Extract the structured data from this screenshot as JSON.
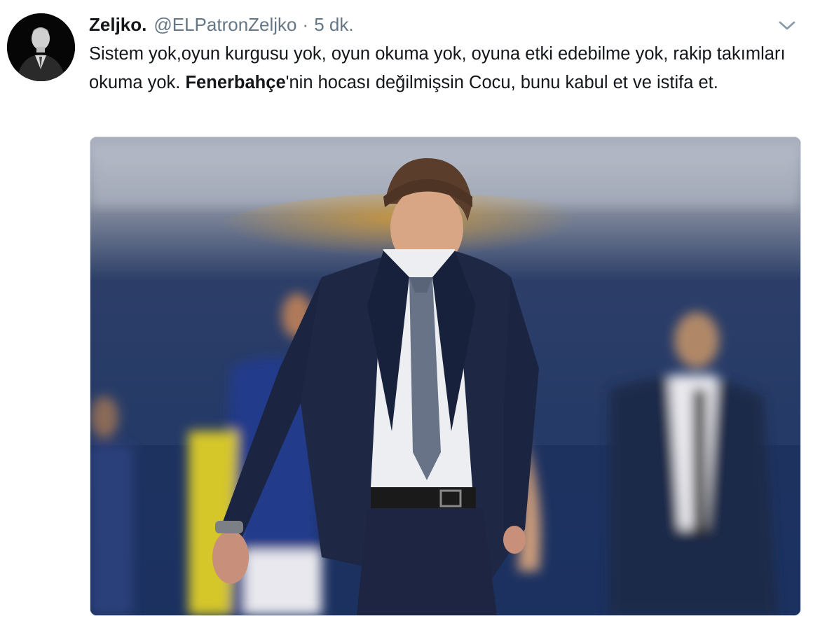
{
  "tweet": {
    "display_name": "Zeljko.",
    "handle": "@ELPatronZeljko",
    "separator": "·",
    "time": "5 dk.",
    "text_part1": "Sistem yok,oyun kurgusu yok, oyun okuma yok, oyuna etki edebilme yok, rakip takımları okuma yok. ",
    "text_bold": "Fenerbahçe",
    "text_part2": "'nin hocası değilmişsin Cocu, bunu kabul et ve istifa et."
  },
  "icons": {
    "menu": "chevron-down-icon"
  },
  "colors": {
    "text_primary": "#14171a",
    "text_secondary": "#657786",
    "border": "#d8dee3"
  }
}
